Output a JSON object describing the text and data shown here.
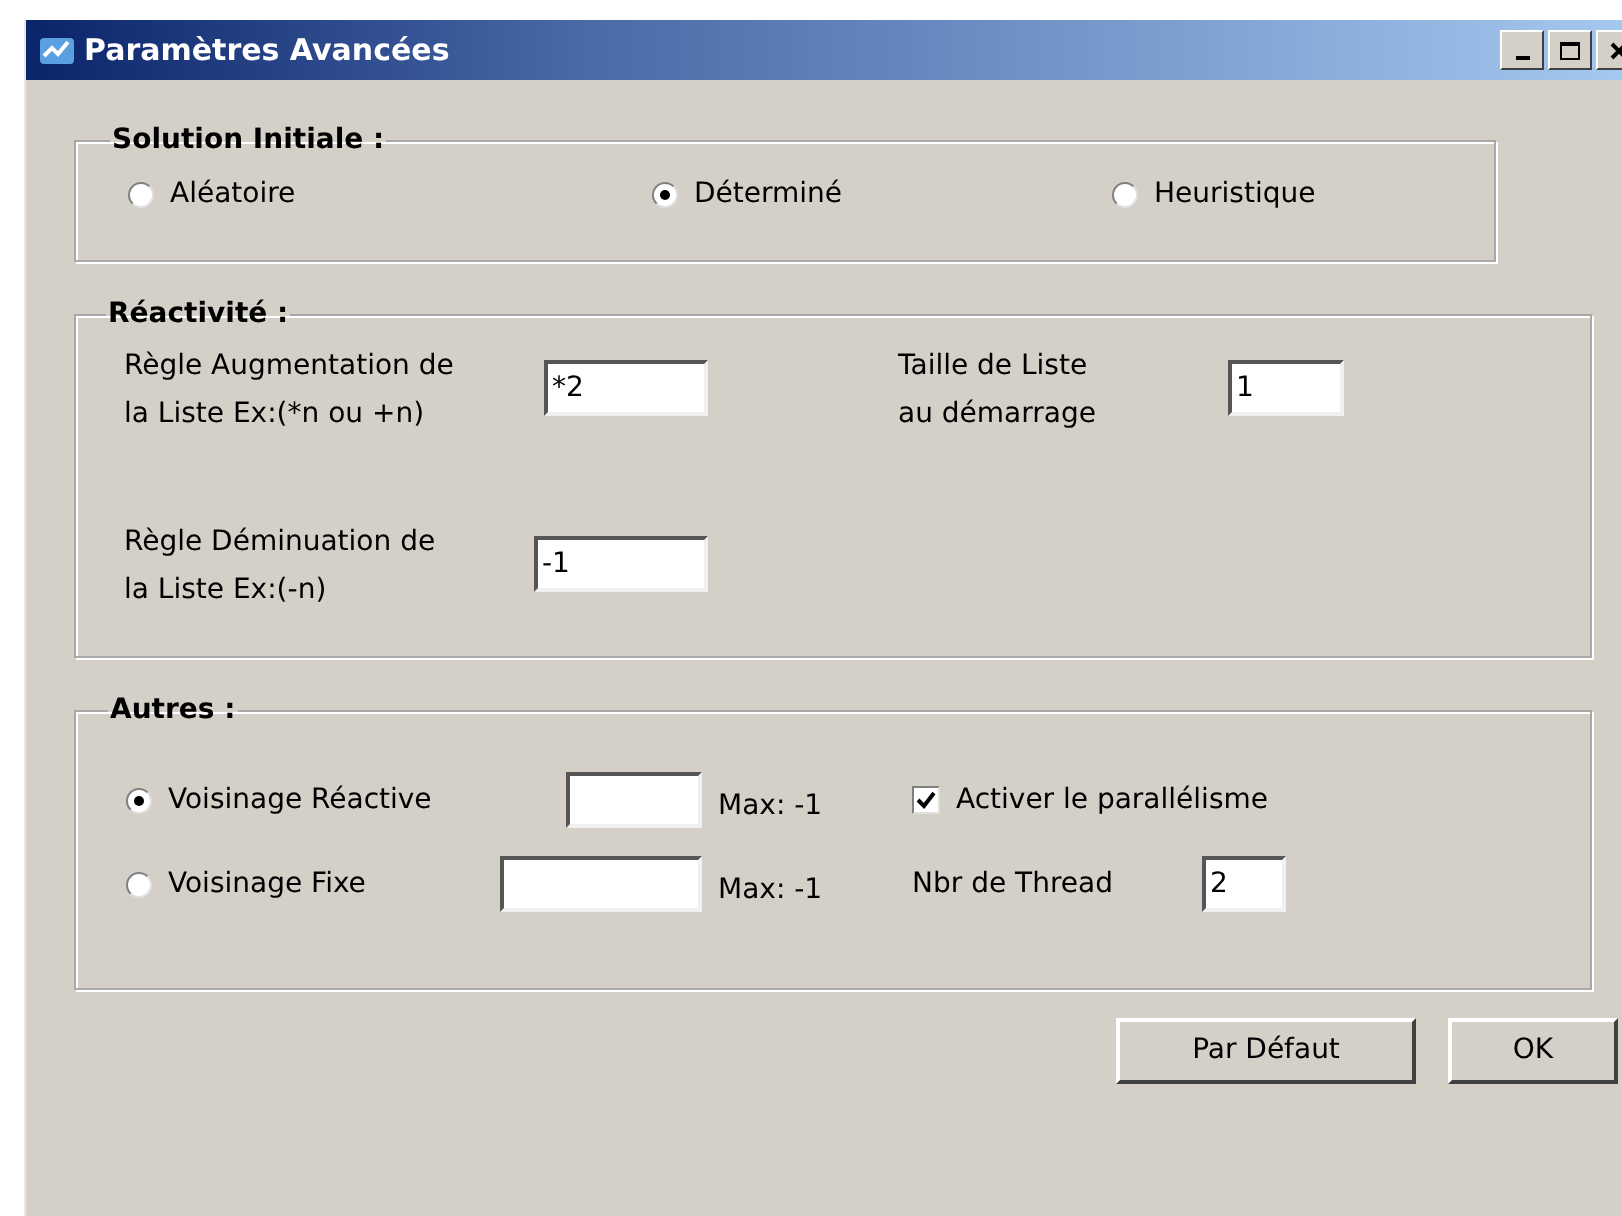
{
  "window": {
    "title": "Paramètres Avancées"
  },
  "solution_initiale": {
    "legend": "Solution Initiale :",
    "options": [
      {
        "label": "Aléatoire",
        "selected": false
      },
      {
        "label": "Déterminé",
        "selected": true
      },
      {
        "label": "Heuristique",
        "selected": false
      }
    ]
  },
  "reactivite": {
    "legend": "Réactivité :",
    "fields": [
      {
        "lines": [
          "Règle Augmentation de",
          "la Liste Ex:(*n ou +n)"
        ],
        "value": "*2"
      },
      {
        "lines": [
          "Taille de Liste",
          "au démarrage"
        ],
        "value": "1"
      },
      {
        "lines": [
          "Règle Déminuation de",
          "la Liste Ex:(-n)"
        ],
        "value": "-1"
      }
    ]
  },
  "autres": {
    "legend": "Autres :",
    "neighborhoods": [
      {
        "label": "Voisinage Réactive",
        "selected": true,
        "max": "Max: -1"
      },
      {
        "label": "Voisinage Fixe",
        "selected": false,
        "max": "Max: -1"
      }
    ],
    "parallel": {
      "label": "Activer le parallélisme",
      "checked": true
    },
    "threads": {
      "label": "Nbr de Thread",
      "value": "2"
    }
  },
  "buttons": [
    "Par Défaut",
    "OK"
  ]
}
